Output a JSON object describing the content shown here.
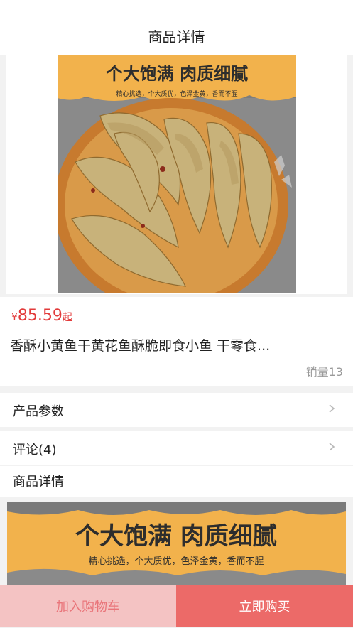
{
  "nav": {
    "title": "商品详情"
  },
  "product": {
    "banner_headline": "个大饱满 肉质细腻",
    "banner_subline": "精心挑选，个大质优，色泽金黄，香而不腥",
    "currency": "¥",
    "price": "85.59",
    "price_suffix": "起",
    "title": "香酥小黄鱼干黄花鱼酥脆即食小鱼 干零食...",
    "sales": "销量13"
  },
  "rows": {
    "params_label": "产品参数",
    "reviews_label": "评论(4)"
  },
  "detail": {
    "heading": "商品详情",
    "banner_headline": "个大饱满 肉质细腻",
    "banner_subline": "精心挑选，个大质优，色泽金黄，香而不腥"
  },
  "actions": {
    "add_to_cart": "加入购物车",
    "buy_now": "立即购买"
  },
  "colors": {
    "accent_red": "#e23b3b",
    "cart_bg": "#f4c3c3",
    "cart_text": "#e9757a",
    "buy_bg": "#ec6a68",
    "banner_yellow": "#f2b24c"
  }
}
